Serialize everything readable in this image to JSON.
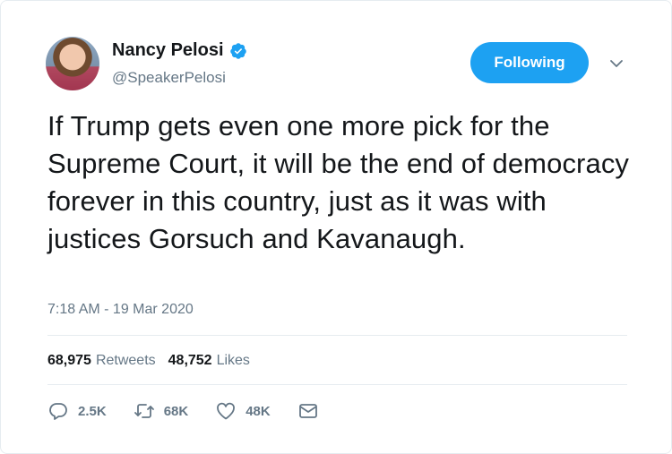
{
  "author": {
    "name": "Nancy Pelosi",
    "handle": "@SpeakerPelosi",
    "verified": true
  },
  "follow_button": {
    "label": "Following"
  },
  "tweet": {
    "text": "If Trump gets even one more pick for the Supreme Court, it will be the end of democracy forever in this country, just as it was with justices Gorsuch and Kavanaugh.",
    "timestamp": "7:18 AM - 19 Mar 2020"
  },
  "stats": {
    "retweets_count": "68,975",
    "retweets_label": "Retweets",
    "likes_count": "48,752",
    "likes_label": "Likes"
  },
  "actions": {
    "reply_count": "2.5K",
    "retweet_count": "68K",
    "like_count": "48K"
  },
  "colors": {
    "accent": "#1da1f2",
    "secondary_text": "#657786",
    "divider": "#e6ecf0"
  },
  "icons": [
    "verified-badge-icon",
    "chevron-down-icon",
    "reply-icon",
    "retweet-icon",
    "like-icon",
    "dm-icon"
  ]
}
